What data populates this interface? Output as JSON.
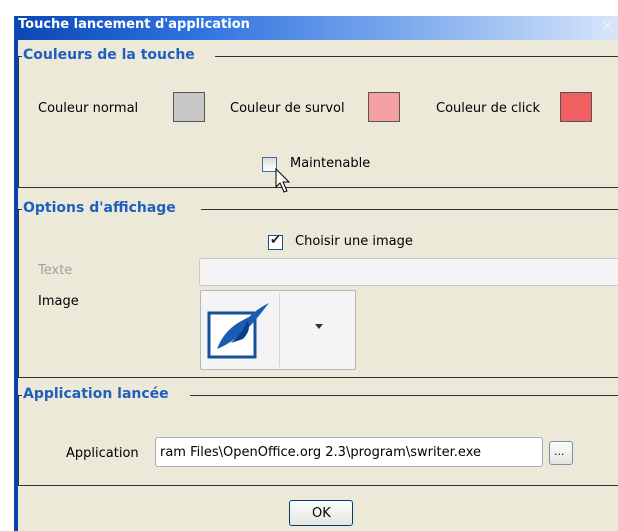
{
  "window": {
    "title": "Touche lancement d'application",
    "close_glyph": "✕"
  },
  "colors": {
    "normal": "#c8c8c8",
    "survol": "#f5a0a0",
    "click": "#f06060",
    "legend": "#1f5fbf",
    "title_bar": "#0a47b4"
  },
  "section_couleurs": {
    "legend": "Couleurs de la touche",
    "label_normal": "Couleur normal",
    "label_survol": "Couleur de survol",
    "label_click": "Couleur de click",
    "maintenable_label": "Maintenable",
    "maintenable_checked": false
  },
  "section_affichage": {
    "legend": "Options d'affichage",
    "choose_image_label": "Choisir une image",
    "choose_image_checked": true,
    "texte_label": "Texte",
    "texte_value": "",
    "image_label": "Image",
    "image_icon": "openoffice-writer-icon"
  },
  "section_application": {
    "legend": "Application lancée",
    "application_label": "Application",
    "application_value": "ram Files\\OpenOffice.org 2.3\\program\\swriter.exe",
    "browse_label": "..."
  },
  "footer": {
    "ok_label": "OK"
  }
}
